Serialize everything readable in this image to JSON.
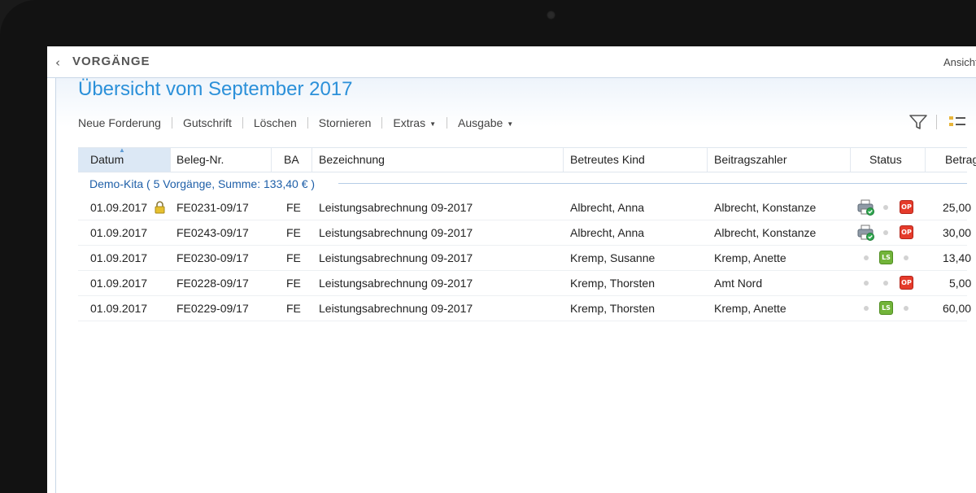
{
  "app": {
    "back_title": "VORGÄNGE",
    "view_link": "Ansicht"
  },
  "page": {
    "title": "Übersicht vom September 2017"
  },
  "toolbar": {
    "items": [
      {
        "label": "Neue Forderung"
      },
      {
        "label": "Gutschrift"
      },
      {
        "label": "Löschen"
      },
      {
        "label": "Stornieren"
      },
      {
        "label": "Extras",
        "dropdown": true
      },
      {
        "label": "Ausgabe",
        "dropdown": true
      }
    ]
  },
  "table": {
    "columns": [
      "Datum",
      "Beleg-Nr.",
      "BA",
      "Bezeichnung",
      "Betreutes Kind",
      "Beitragszahler",
      "Status",
      "Betrag"
    ],
    "group": {
      "label": "Demo-Kita  ( 5 Vorgänge, Summe: 133,40 € )"
    },
    "rows": [
      {
        "datum": "01.09.2017",
        "beleg": "FE0231-09/17",
        "ba": "FE",
        "bezeichnung": "Leistungsabrechnung 09-2017",
        "kind": "Albrecht, Anna",
        "zahler": "Albrecht, Konstanze",
        "betrag": "25,00",
        "locked": true,
        "status": [
          "printer",
          "dot",
          "OP"
        ]
      },
      {
        "datum": "01.09.2017",
        "beleg": "FE0243-09/17",
        "ba": "FE",
        "bezeichnung": "Leistungsabrechnung 09-2017",
        "kind": "Albrecht, Anna",
        "zahler": "Albrecht, Konstanze",
        "betrag": "30,00",
        "locked": false,
        "status": [
          "printer",
          "dot",
          "OP"
        ]
      },
      {
        "datum": "01.09.2017",
        "beleg": "FE0230-09/17",
        "ba": "FE",
        "bezeichnung": "Leistungsabrechnung 09-2017",
        "kind": "Kremp, Susanne",
        "zahler": "Kremp, Anette",
        "betrag": "13,40",
        "locked": false,
        "status": [
          "dot",
          "LS",
          "dot"
        ]
      },
      {
        "datum": "01.09.2017",
        "beleg": "FE0228-09/17",
        "ba": "FE",
        "bezeichnung": "Leistungsabrechnung 09-2017",
        "kind": "Kremp, Thorsten",
        "zahler": "Amt Nord",
        "betrag": "5,00",
        "locked": false,
        "status": [
          "dot",
          "dot",
          "OP"
        ]
      },
      {
        "datum": "01.09.2017",
        "beleg": "FE0229-09/17",
        "ba": "FE",
        "bezeichnung": "Leistungsabrechnung 09-2017",
        "kind": "Kremp, Thorsten",
        "zahler": "Kremp, Anette",
        "betrag": "60,00",
        "locked": false,
        "status": [
          "dot",
          "LS",
          "dot"
        ]
      }
    ]
  },
  "badges": {
    "op": "OP",
    "ls": "LS"
  },
  "colors": {
    "accent": "#2b90d9",
    "group_text": "#1e5fa8",
    "op_badge": "#e53b2b",
    "ls_badge": "#72b43a"
  }
}
